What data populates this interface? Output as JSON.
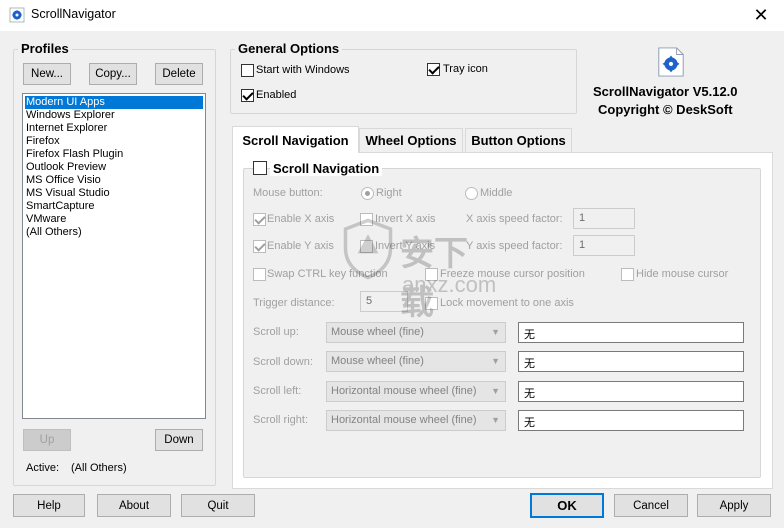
{
  "window": {
    "title": "ScrollNavigator",
    "close_glyph": "✕",
    "app_icon": "scroll-navigator-icon"
  },
  "profiles": {
    "title": "Profiles",
    "new_label": "New...",
    "copy_label": "Copy...",
    "delete_label": "Delete",
    "items": [
      "Modern UI Apps",
      "Windows Explorer",
      "Internet Explorer",
      "Firefox",
      "Firefox Flash Plugin",
      "Outlook Preview",
      "MS Office Visio",
      "MS Visual Studio",
      "SmartCapture",
      "VMware",
      "(All Others)"
    ],
    "selected_index": 0,
    "up_label": "Up",
    "down_label": "Down",
    "active_label": "Active:",
    "active_value": "(All Others)"
  },
  "general": {
    "title": "General Options",
    "start_with_windows": "Start with Windows",
    "tray_icon": "Tray icon",
    "enabled": "Enabled",
    "start_checked": false,
    "tray_checked": true,
    "enabled_checked": true
  },
  "about": {
    "product": "ScrollNavigator V5.12.0",
    "copyright": "Copyright © DeskSoft"
  },
  "tabs": [
    "Scroll Navigation",
    "Wheel Options",
    "Button Options"
  ],
  "scroll_nav": {
    "section_title": "Scroll Navigation",
    "mouse_button_label": "Mouse button:",
    "right_label": "Right",
    "middle_label": "Middle",
    "enable_x": "Enable X axis",
    "invert_x": "Invert X axis",
    "x_speed_label": "X axis speed factor:",
    "x_speed_value": "1",
    "enable_y": "Enable Y axis",
    "invert_y": "Invert Y axis",
    "y_speed_label": "Y axis speed factor:",
    "y_speed_value": "1",
    "swap_ctrl": "Swap CTRL key function",
    "freeze_cursor": "Freeze mouse cursor position",
    "hide_cursor": "Hide mouse cursor",
    "trigger_label": "Trigger distance:",
    "trigger_value": "5",
    "lock_axis": "Lock movement to one axis",
    "rows": [
      {
        "label": "Scroll up:",
        "action": "Mouse wheel (fine)",
        "value": "无"
      },
      {
        "label": "Scroll down:",
        "action": "Mouse wheel (fine)",
        "value": "无"
      },
      {
        "label": "Scroll left:",
        "action": "Horizontal mouse wheel (fine)",
        "value": "无"
      },
      {
        "label": "Scroll right:",
        "action": "Horizontal mouse wheel (fine)",
        "value": "无"
      }
    ]
  },
  "footer": {
    "help": "Help",
    "about": "About",
    "quit": "Quit",
    "ok": "OK",
    "cancel": "Cancel",
    "apply": "Apply"
  },
  "watermark": {
    "text": "安下载",
    "url": "anxz.com"
  },
  "colors": {
    "accent": "#0078d7",
    "selection": "#0078d7",
    "disabled_text": "#a0a0a0"
  }
}
